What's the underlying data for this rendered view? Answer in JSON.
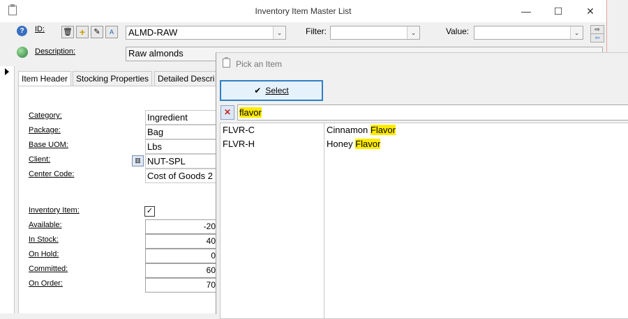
{
  "window": {
    "title": "Inventory Item Master List",
    "minimize": "—",
    "maximize": "☐",
    "close": "✕"
  },
  "toolbar": {
    "id_label": "ID:",
    "id_value": "ALMD-RAW",
    "filter_label": "Filter:",
    "filter_value": "",
    "value_label": "Value:",
    "value_value": ""
  },
  "description": {
    "label": "Description:",
    "value": "Raw almonds"
  },
  "tabs": [
    "Item Header",
    "Stocking Properties",
    "Detailed Descri"
  ],
  "header_fields": [
    {
      "label": "Category:",
      "value": "Ingredient"
    },
    {
      "label": "Package:",
      "value": "Bag"
    },
    {
      "label": "Base UOM:",
      "value": "Lbs"
    },
    {
      "label": "Client:",
      "value": "NUT-SPL"
    },
    {
      "label": "Center Code:",
      "value": "Cost of Goods 2"
    }
  ],
  "inventory": {
    "inventory_item_label": "Inventory Item:",
    "inventory_item_checked": true,
    "rows": [
      {
        "label": "Available:",
        "value": "-20"
      },
      {
        "label": "In Stock:",
        "value": "40"
      },
      {
        "label": "On Hold:",
        "value": "0"
      },
      {
        "label": "Committed:",
        "value": "60"
      },
      {
        "label": "On Order:",
        "value": "70"
      }
    ]
  },
  "popup": {
    "title": "Pick an Item",
    "select_label": "Select",
    "search_value": "flavor",
    "results": [
      {
        "id": "FLVR-C",
        "prefix": "Cinnamon ",
        "match": "Flavor"
      },
      {
        "id": "FLVR-H",
        "prefix": "Honey ",
        "match": "Flavor"
      }
    ]
  },
  "colors": {
    "highlight": "#ffeb00",
    "select_border": "#2f7fc4"
  }
}
